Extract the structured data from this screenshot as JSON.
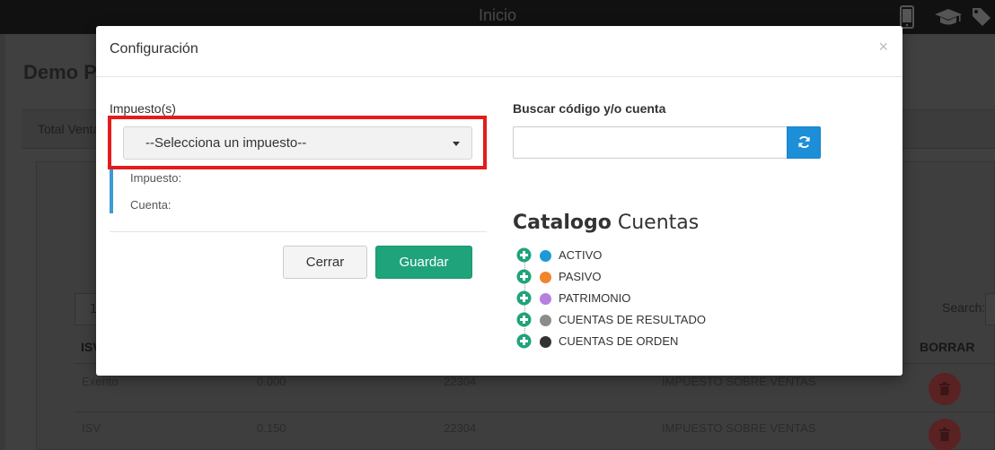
{
  "topbar": {
    "title": "Inicio",
    "icons": [
      "mobile-phone-icon",
      "graduation-cap-icon",
      "tags-icon"
    ]
  },
  "background": {
    "page_title": "Demo P",
    "tab_label": "Total Venta",
    "length_value": "1",
    "search_label": "Search:",
    "table": {
      "headers": [
        "ISV",
        "BORRAR"
      ],
      "rows": [
        [
          "Exento",
          "0.000",
          "22304",
          "IMPUESTO SOBRE VENTAS"
        ],
        [
          "ISV",
          "0.150",
          "22304",
          "IMPUESTO SOBRE VENTAS"
        ]
      ]
    }
  },
  "modal": {
    "title": "Configuración",
    "close_label": "×",
    "impuestos_label": "Impuesto(s)",
    "impuesto_select": {
      "selected": "--Selecciona un impuesto--"
    },
    "info": {
      "impuesto_label": "Impuesto:",
      "cuenta_label": "Cuenta:"
    },
    "buttons": {
      "cerrar": "Cerrar",
      "guardar": "Guardar"
    },
    "search": {
      "label": "Buscar código y/o cuenta",
      "value": "",
      "refresh_icon": "refresh-icon"
    },
    "catalog": {
      "title_bold": "Catalogo",
      "title_light": "Cuentas",
      "items": [
        {
          "label": "ACTIVO",
          "color": "#1d9ad6"
        },
        {
          "label": "PASIVO",
          "color": "#f0852d"
        },
        {
          "label": "PATRIMONIO",
          "color": "#b77fe0"
        },
        {
          "label": "CUENTAS DE RESULTADO",
          "color": "#8c8c8c"
        },
        {
          "label": "CUENTAS DE ORDEN",
          "color": "#333333"
        }
      ]
    }
  },
  "colors": {
    "highlight": "#e31c1c",
    "guardar": "#1fa37a",
    "refresh_button": "#1d8fd8",
    "tree_plus": "#1fa37a",
    "info_bar": "#3c9ad8"
  }
}
